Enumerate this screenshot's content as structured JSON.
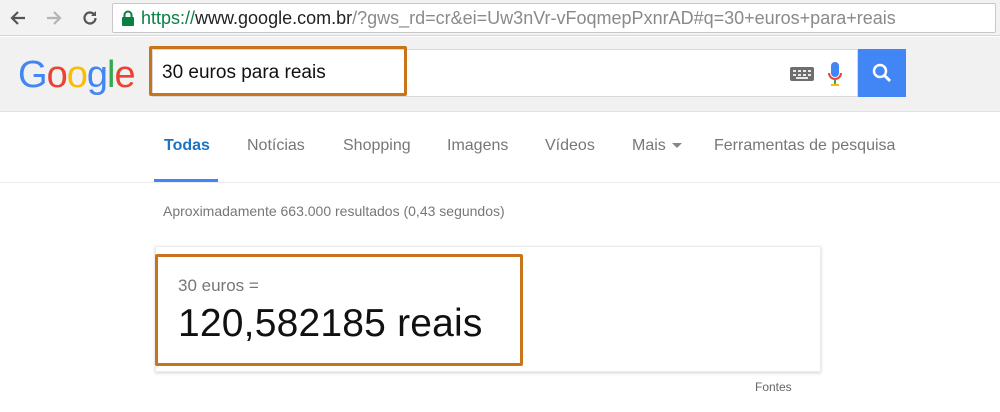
{
  "browser": {
    "url_scheme": "https://",
    "url_host": "www.google.com.br",
    "url_rest": "/?gws_rd=cr&ei=Uw3nVr-vFoqmepPxnrAD#q=30+euros+para+reais"
  },
  "header": {
    "logo_letters": [
      "G",
      "o",
      "o",
      "g",
      "l",
      "e"
    ],
    "logo_colors": [
      "#4285f4",
      "#ea4335",
      "#fbbc05",
      "#4285f4",
      "#34a853",
      "#ea4335"
    ],
    "query": "30 euros para reais"
  },
  "tabs": [
    {
      "label": "Todas",
      "active": true
    },
    {
      "label": "Notícias",
      "active": false
    },
    {
      "label": "Shopping",
      "active": false
    },
    {
      "label": "Imagens",
      "active": false
    },
    {
      "label": "Vídeos",
      "active": false
    },
    {
      "label": "Mais",
      "active": false
    },
    {
      "label": "Ferramentas de pesquisa",
      "active": false
    }
  ],
  "results": {
    "stats": "Aproximadamente 663.000 resultados (0,43 segundos)"
  },
  "converter": {
    "lhs": "30 euros =",
    "rhs": "120,582185 reais",
    "source_link": "Fontes"
  },
  "colors": {
    "accent_blue": "#4285f4",
    "highlight_orange": "#c8741b",
    "url_green": "#0b8043"
  }
}
